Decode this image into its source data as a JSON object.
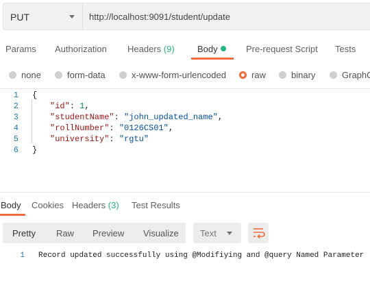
{
  "request": {
    "method": "PUT",
    "url": "http://localhost:9091/student/update"
  },
  "request_tabs": [
    {
      "label": "Params"
    },
    {
      "label": "Authorization"
    },
    {
      "label": "Headers",
      "count": "(9)"
    },
    {
      "label": "Body",
      "active": true
    },
    {
      "label": "Pre-request Script"
    },
    {
      "label": "Tests"
    }
  ],
  "body_types": [
    {
      "label": "none"
    },
    {
      "label": "form-data"
    },
    {
      "label": "x-www-form-urlencoded"
    },
    {
      "label": "raw",
      "selected": true
    },
    {
      "label": "binary"
    },
    {
      "label": "GraphQ"
    }
  ],
  "editor": {
    "lines": [
      {
        "num": "1",
        "text": "{"
      },
      {
        "num": "2",
        "key": "\"id\"",
        "sep": ": ",
        "value": "1",
        "value_type": "number",
        "trail": ","
      },
      {
        "num": "3",
        "key": "\"studentName\"",
        "sep": ": ",
        "value": "\"john_updated_name\"",
        "value_type": "string",
        "trail": ","
      },
      {
        "num": "4",
        "key": "\"rollNumber\"",
        "sep": ": ",
        "value": "\"0126CS01\"",
        "value_type": "string",
        "trail": ","
      },
      {
        "num": "5",
        "key": "\"university\"",
        "sep": ": ",
        "value": "\"rgtu\"",
        "value_type": "string",
        "trail": ""
      },
      {
        "num": "6",
        "text": "}"
      }
    ]
  },
  "response_tabs": [
    {
      "label": "Body",
      "active": true
    },
    {
      "label": "Cookies"
    },
    {
      "label": "Headers",
      "count": "(3)"
    },
    {
      "label": "Test Results"
    }
  ],
  "response_toolbar": {
    "views": [
      "Pretty",
      "Raw",
      "Preview",
      "Visualize"
    ],
    "active_view": "Pretty",
    "format": "Text"
  },
  "response": {
    "line_num": "1",
    "text": "Record updated successfully using @Modifiying and @query Named Parameter"
  },
  "colors": {
    "accent": "#f26b3a",
    "count_green": "#26b47f"
  }
}
